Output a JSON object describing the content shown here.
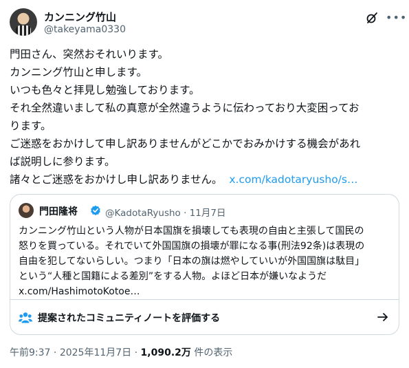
{
  "author": {
    "name": "カンニング竹山",
    "handle": "@takeyama0330"
  },
  "icons": {
    "grok": "grok-icon",
    "more": "more-icon",
    "verified": "verified-badge-icon",
    "community": "people-icon",
    "arrow": "arrow-right-icon"
  },
  "colors": {
    "link": "#1d9bf0",
    "muted": "#536471",
    "verified": "#1d9bf0"
  },
  "tweet": {
    "lines": [
      "門田さん、突然おそれいります。",
      "カンニング竹山と申します。",
      "いつも色々と拝見し勉強しております。",
      "それ全然違いまして私の真意が全然違うように伝わっており大変困ってお",
      "ります。",
      "ご迷惑をおかけして申し訳ありませんがどこかでおみかけする機会があれ",
      "ば説明しに参ります。",
      "諸々とご迷惑をおかけし申し訳ありません。"
    ],
    "link": "x.com/kadotaryusho/s…"
  },
  "quote": {
    "name": "門田隆将",
    "handle": "@KadotaRyusho",
    "date": "11月7日",
    "lines": [
      "カンニング竹山という人物が日本国旗を損壊しても表現の自由と主張して国民の",
      "怒りを買っている。それでいて外国国旗の損壊が罪になる事(刑法92条)は表現の",
      "自由を犯してないらしい。つまり「日本の旗は燃やしていいが外国国旗は駄目」",
      "という“人種と国籍による差別”をする人物。よほど日本が嫌いなようだ",
      "x.com/HashimotoKotoe…"
    ]
  },
  "community_note": {
    "label": "提案されたコミュニティノートを評価する"
  },
  "meta": {
    "time": "午前9:37",
    "date": "2025年11月7日",
    "views": "1,090.2万",
    "views_suffix": " 件の表示"
  }
}
